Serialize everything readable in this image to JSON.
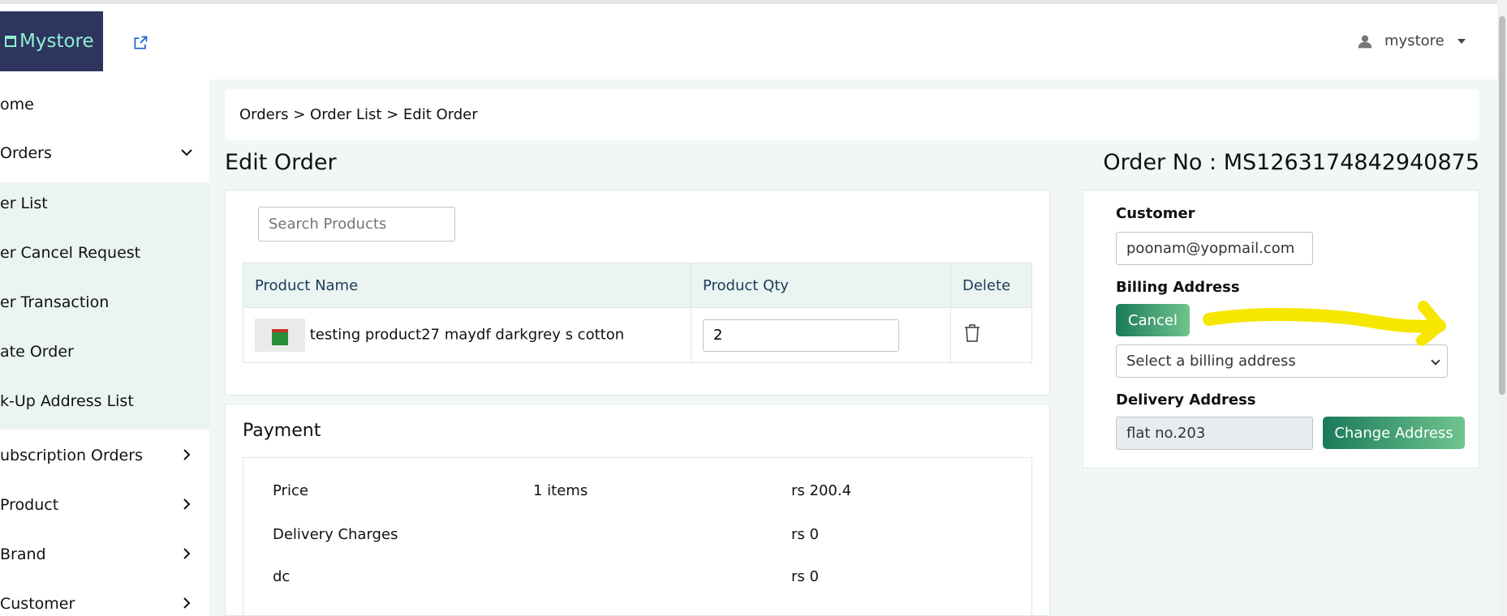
{
  "header": {
    "logo_text": "Mystore",
    "user_name": "mystore"
  },
  "sidebar": {
    "items": [
      {
        "label": "ome"
      },
      {
        "label": "Orders"
      },
      {
        "label": "er List"
      },
      {
        "label": "er Cancel Request"
      },
      {
        "label": "er Transaction"
      },
      {
        "label": "ate Order"
      },
      {
        "label": "k-Up Address List"
      },
      {
        "label": "ubscription Orders"
      },
      {
        "label": "Product"
      },
      {
        "label": "Brand"
      },
      {
        "label": "Customer"
      }
    ]
  },
  "breadcrumb": "Orders > Order List > Edit Order",
  "page": {
    "title": "Edit Order",
    "order_no": "Order No : MS1263174842940875"
  },
  "products": {
    "search_placeholder": "Search Products",
    "headers": [
      "Product Name",
      "Product Qty",
      "Delete"
    ],
    "rows": [
      {
        "name": "testing product27 maydf darkgrey s cotton",
        "qty": "2"
      }
    ]
  },
  "payment": {
    "title": "Payment",
    "rows": [
      {
        "label": "Price",
        "items": "1 items",
        "value": "rs 200.4"
      },
      {
        "label": "Delivery Charges",
        "items": "",
        "value": "rs 0"
      },
      {
        "label": "dc",
        "items": "",
        "value": "rs 0"
      }
    ]
  },
  "customer_panel": {
    "customer_label": "Customer",
    "customer_value": "poonam@yopmail.com",
    "billing_label": "Billing Address",
    "cancel_label": "Cancel",
    "billing_select": "Select a billing address",
    "delivery_label": "Delivery Address",
    "delivery_value": "flat no.203",
    "change_label": "Change Address"
  },
  "colors": {
    "brand": "#2e355f",
    "accent_green": "#1b7a5a",
    "highlight": "#f7e600"
  }
}
